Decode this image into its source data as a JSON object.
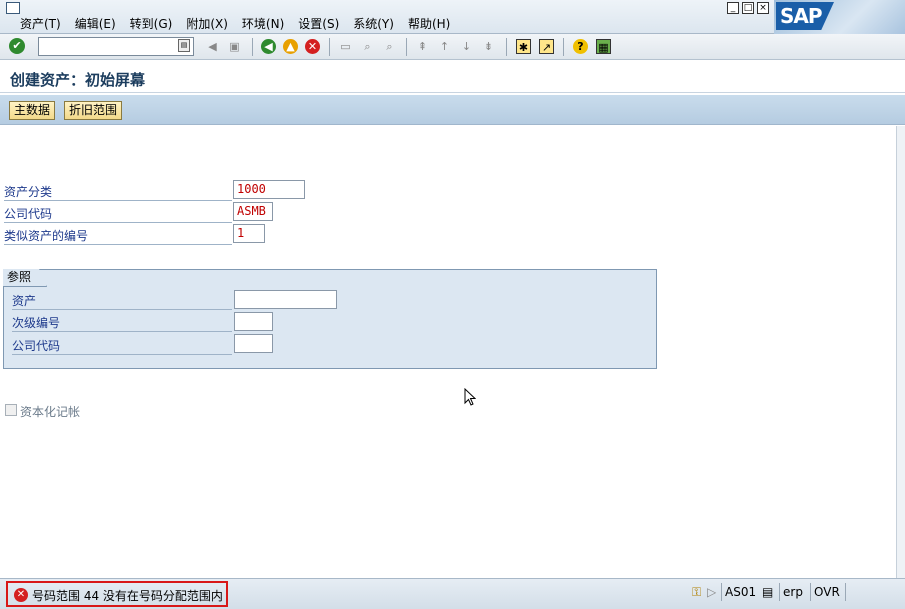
{
  "menubar": {
    "items": [
      "资产(T)",
      "编辑(E)",
      "转到(G)",
      "附加(X)",
      "环境(N)",
      "设置(S)",
      "系统(Y)",
      "帮助(H)"
    ],
    "logo": "SAP"
  },
  "toolbar": {
    "command_value": ""
  },
  "title": "创建资产：初始屏幕",
  "app_toolbar": {
    "master_data": "主数据",
    "depreciation_areas": "折旧范围"
  },
  "form": {
    "asset_class": {
      "label": "资产分类",
      "value": "1000"
    },
    "company_code": {
      "label": "公司代码",
      "value": "ASMB"
    },
    "similar_assets": {
      "label": "类似资产的编号",
      "value": "1"
    }
  },
  "reference": {
    "title": "参照",
    "asset": {
      "label": "资产",
      "value": ""
    },
    "sub_number": {
      "label": "次级编号",
      "value": ""
    },
    "company_code": {
      "label": "公司代码",
      "value": ""
    }
  },
  "capitalize": {
    "label": "资本化记帐"
  },
  "status": {
    "message": "号码范围 44 没有在号码分配范围内",
    "transaction": "AS01",
    "server": "erp",
    "mode": "OVR"
  },
  "colors": {
    "error": "#d42020",
    "label": "#1e3a8c",
    "field_value": "#c00000",
    "app_toolbar": "#c9dcec"
  }
}
